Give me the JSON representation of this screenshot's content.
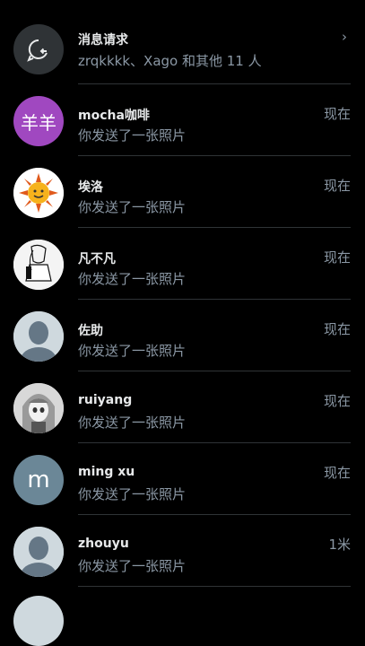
{
  "requests": {
    "title": "消息请求",
    "subtitle": "zrqkkkk、Xago 和其他 11 人",
    "chevron": "›",
    "icon": "message-request-icon"
  },
  "conversations": [
    {
      "name": "mocha咖啡",
      "message": "你发送了一张照片",
      "time": "现在",
      "avatar_text": "羊羊",
      "avatar_color": "#a048c0"
    },
    {
      "name": "埃洛",
      "message": "你发送了一张照片",
      "time": "现在",
      "avatar": "sun-cartoon"
    },
    {
      "name": "凡不凡",
      "message": "你发送了一张照片",
      "time": "现在",
      "avatar": "anime-sketch"
    },
    {
      "name": "佐助",
      "message": "你发送了一张照片",
      "time": "现在",
      "avatar": "default-profile"
    },
    {
      "name": "ruiyang",
      "message": "你发送了一张照片",
      "time": "现在",
      "avatar": "anime-girl"
    },
    {
      "name": "ming xu",
      "message": "你发送了一张照片",
      "time": "现在",
      "avatar_text": "m",
      "avatar_color": "#6b8797"
    },
    {
      "name": "zhouyu",
      "message": "你发送了一张照片",
      "time": "1米",
      "avatar": "default-profile"
    }
  ],
  "colors": {
    "background": "#000000",
    "secondary_text": "#8b98a5",
    "primary_text": "#e7e9ea",
    "divider": "#2f3336"
  }
}
